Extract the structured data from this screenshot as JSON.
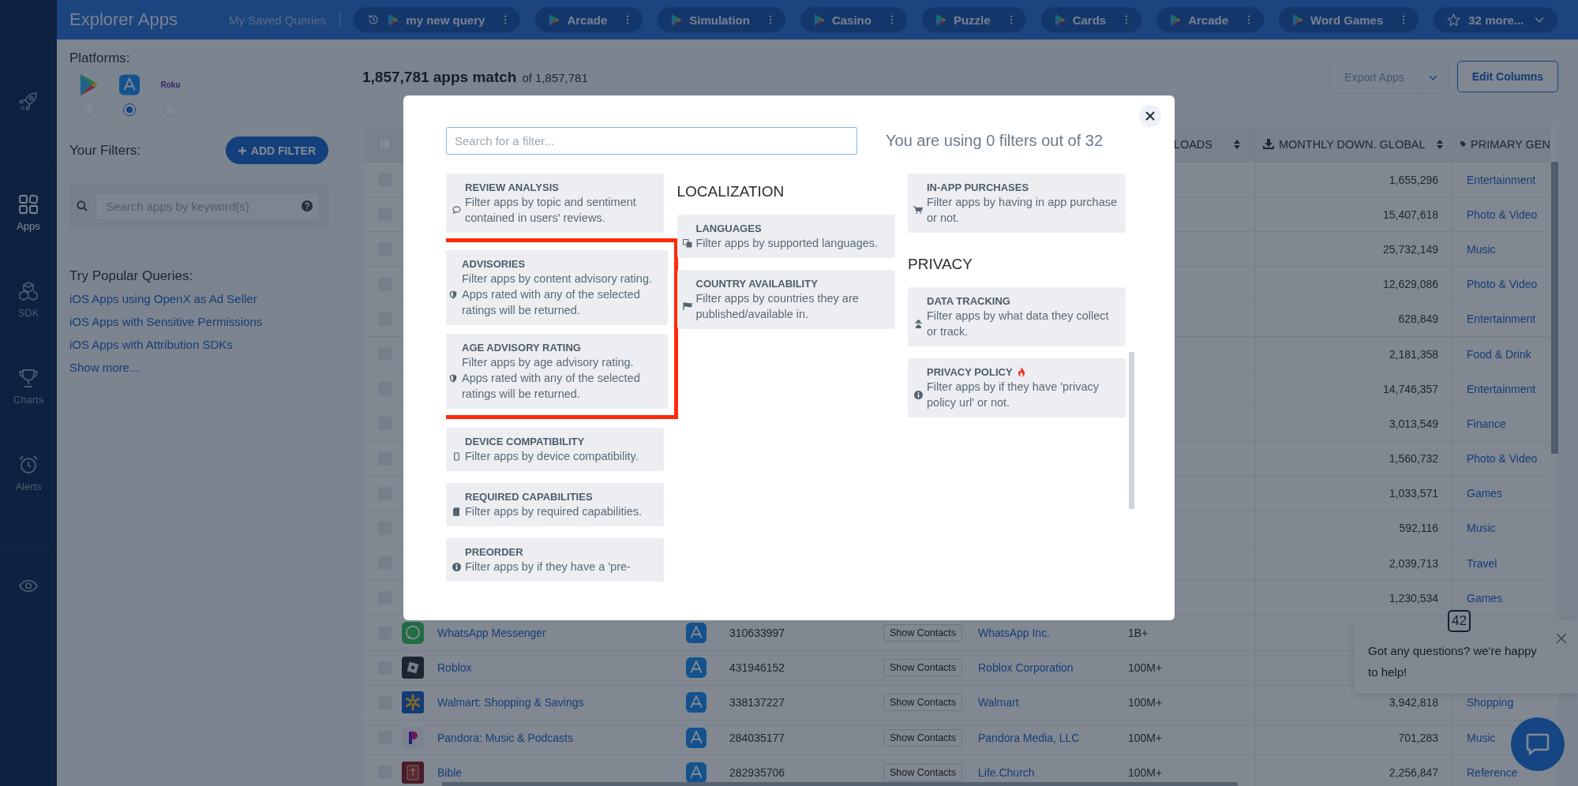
{
  "top_bar": {
    "title": "Explorer Apps",
    "saved_label": "My Saved Queries",
    "queries": [
      {
        "label": "my new query",
        "kind": "recent"
      },
      {
        "label": "Arcade",
        "kind": "saved"
      },
      {
        "label": "Simulation",
        "kind": "saved"
      },
      {
        "label": "Casino",
        "kind": "saved"
      },
      {
        "label": "Puzzle",
        "kind": "saved"
      },
      {
        "label": "Cards",
        "kind": "saved"
      },
      {
        "label": "Arcade",
        "kind": "saved"
      },
      {
        "label": "Word Games",
        "kind": "saved"
      }
    ],
    "more": "32 more..."
  },
  "nav_rail": {
    "items": [
      {
        "label": "Apps",
        "selected": true
      },
      {
        "label": "SDK",
        "selected": false
      },
      {
        "label": "Charts",
        "selected": false
      },
      {
        "label": "Alerts",
        "selected": false
      }
    ]
  },
  "filters_panel": {
    "platforms_label": "Platforms:",
    "platforms": [
      {
        "kind": "play",
        "selected": false
      },
      {
        "kind": "store",
        "selected": true
      },
      {
        "kind": "wordmark",
        "label": "Roku",
        "selected": false
      }
    ],
    "filters_label": "Your Filters:",
    "add_filter": "ADD FILTER",
    "search": {
      "placeholder": "Search apps by keyword(s)"
    },
    "popular_label": "Try Popular Queries:",
    "popular_queries": [
      "iOS Apps using OpenX as Ad Seller",
      "iOS Apps with Sensitive Permissions",
      "iOS Apps with Attribution SDKs"
    ],
    "show_more": "Show more..."
  },
  "results": {
    "count": "1,857,781 apps match",
    "total": "of 1,857,781",
    "export": {
      "label": "Export Apps",
      "disabled": true
    },
    "edit_columns": "Edit Columns"
  },
  "table": {
    "select_all": {
      "checked": false
    },
    "columns": [
      "LOADS",
      "MONTHLY DOWN. GLOBAL",
      "PRIMARY GEN"
    ],
    "rows": [
      {
        "checked": false,
        "monthly": "1,655,296",
        "genre": "Entertainment"
      },
      {
        "checked": false,
        "monthly": "15,407,618",
        "genre": "Photo & Video"
      },
      {
        "checked": false,
        "monthly": "25,732,149",
        "genre": "Music"
      },
      {
        "checked": false,
        "monthly": "12,629,086",
        "genre": "Photo & Video"
      },
      {
        "checked": false,
        "monthly": "628,849",
        "genre": "Entertainment"
      },
      {
        "checked": false,
        "monthly": "2,181,358",
        "genre": "Food & Drink"
      },
      {
        "checked": false,
        "monthly": "14,746,357",
        "genre": "Entertainment"
      },
      {
        "checked": false,
        "monthly": "3,013,549",
        "genre": "Finance"
      },
      {
        "checked": false,
        "monthly": "1,560,732",
        "genre": "Photo & Video"
      },
      {
        "checked": false,
        "monthly": "1,033,571",
        "genre": "Games"
      },
      {
        "checked": false,
        "monthly": "592,116",
        "genre": "Music"
      },
      {
        "checked": false,
        "monthly": "2,039,713",
        "genre": "Travel"
      },
      {
        "checked": false,
        "monthly": "1,230,534",
        "genre": "Games"
      },
      {
        "checked": false,
        "name": "WhatsApp Messenger",
        "store_id": "310633997",
        "contacts": "Show Contacts",
        "publisher": "WhatsApp Inc.",
        "downloads": "1B+"
      },
      {
        "checked": false,
        "name": "Roblox",
        "store_id": "431946152",
        "contacts": "Show Contacts",
        "publisher": "Roblox Corporation",
        "downloads": "100M+"
      },
      {
        "checked": false,
        "name": "Walmart: Shopping & Savings",
        "store_id": "338137227",
        "contacts": "Show Contacts",
        "publisher": "Walmart",
        "downloads": "100M+",
        "monthly": "3,942,818",
        "genre": "Shopping"
      },
      {
        "checked": false,
        "name": "Pandora: Music & Podcasts",
        "store_id": "284035177",
        "contacts": "Show Contacts",
        "publisher": "Pandora Media, LLC",
        "downloads": "100M+",
        "monthly": "701,283",
        "genre": "Music"
      },
      {
        "checked": false,
        "name": "Bible",
        "store_id": "282935706",
        "contacts": "Show Contacts",
        "publisher": "Life.Church",
        "downloads": "100M+",
        "monthly": "2,256,847",
        "genre": "Reference"
      }
    ]
  },
  "modal": {
    "search": {
      "placeholder": "Search for a filter..."
    },
    "usage": "You are using 0 filters out of 32",
    "columns": [
      {
        "sections": [
          {
            "items": [
              {
                "title": "REVIEW ANALYSIS",
                "description": "Filter apps by topic and sentiment contained in users' reviews.",
                "highlighted": false,
                "hot": false
              },
              {
                "title": "ADVISORIES",
                "description": "Filter apps by content advisory rating. Apps rated with any of the selected ratings will be returned.",
                "highlighted": true,
                "hot": false
              },
              {
                "title": "AGE ADVISORY RATING",
                "description": "Filter apps by age advisory rating. Apps rated with any of the selected ratings will be returned.",
                "highlighted": true,
                "hot": false
              },
              {
                "title": "DEVICE COMPATIBILITY",
                "description": "Filter apps by device compatibility.",
                "highlighted": false,
                "hot": false
              },
              {
                "title": "REQUIRED CAPABILITIES",
                "description": "Filter apps by required capabilities.",
                "highlighted": false,
                "hot": false
              },
              {
                "title": "PREORDER",
                "description": "Filter apps by if they have a 'pre-",
                "highlighted": false,
                "hot": false
              }
            ]
          }
        ]
      },
      {
        "sections": [
          {
            "heading": "LOCALIZATION",
            "items": [
              {
                "title": "LANGUAGES",
                "description": "Filter apps by supported languages.",
                "highlighted": false,
                "hot": false
              },
              {
                "title": "COUNTRY AVAILABILITY",
                "description": "Filter apps by countries they are published/available in.",
                "highlighted": false,
                "hot": false
              }
            ]
          }
        ]
      },
      {
        "sections": [
          {
            "items": [
              {
                "title": "IN-APP PURCHASES",
                "description": "Filter apps by having in app purchase or not.",
                "highlighted": false,
                "hot": false
              }
            ]
          },
          {
            "heading": "PRIVACY",
            "items": [
              {
                "title": "DATA TRACKING",
                "description": "Filter apps by what data they collect or track.",
                "highlighted": false,
                "hot": false
              },
              {
                "title": "PRIVACY POLICY",
                "description": "Filter apps by if they have 'privacy policy url' or not.",
                "highlighted": false,
                "hot": true
              }
            ]
          }
        ]
      }
    ]
  },
  "chat": {
    "badge": "42",
    "message": "Got any questions? we're happy to help!"
  }
}
